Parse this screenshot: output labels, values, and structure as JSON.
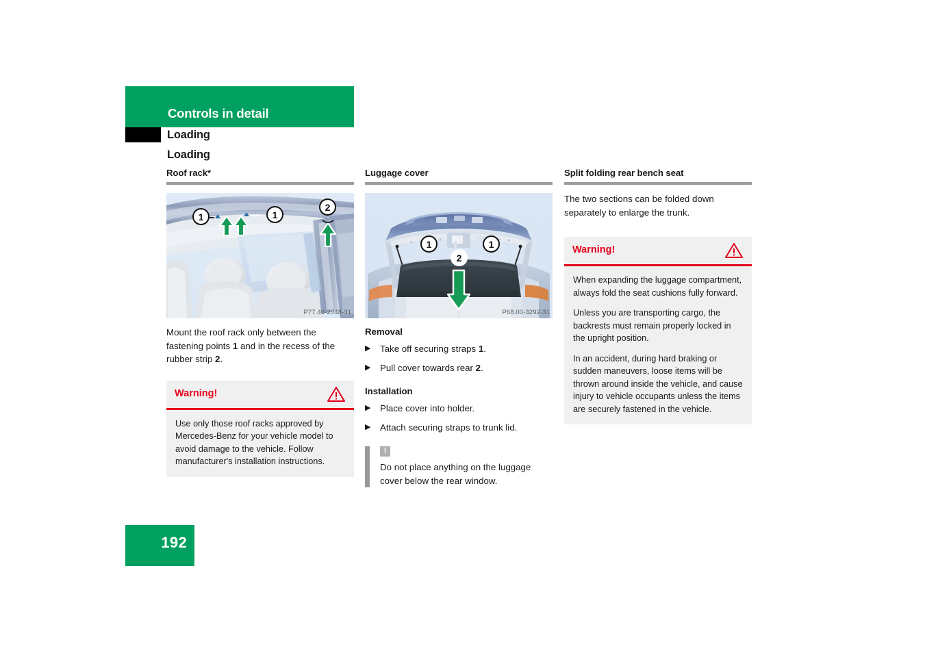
{
  "header": {
    "chapter": "Controls in detail",
    "running_head": "Loading",
    "section": "Loading"
  },
  "columns": {
    "col1": {
      "title": "Roof rack*",
      "figure": {
        "code": "P77.40-2048-31",
        "callouts": [
          "1",
          "1",
          "2"
        ],
        "alt": "car interior roof with fastening points"
      },
      "paragraph_html": "Mount the roof rack only between the fastening points <b>1</b> and in the recess of the rubber strip <b>2</b>.",
      "warning": {
        "title": "Warning!",
        "icon": "warning-triangle-icon",
        "paragraphs": [
          "Use only those roof racks approved by Mercedes-Benz for your vehicle model to avoid damage to the vehicle. Follow manufacturer's installation instructions."
        ]
      }
    },
    "col2": {
      "title": "Luggage cover",
      "figure": {
        "code": "P68.00-3292-31",
        "callouts": [
          "1",
          "1",
          "2"
        ],
        "alt": "open trunk lid with luggage cover"
      },
      "removal_head": "Removal",
      "removal_items_html": [
        "Take off securing straps <b>1</b>.",
        "Pull cover towards rear <b>2</b>."
      ],
      "installation_head": "Installation",
      "installation_items_html": [
        "Place cover into holder.",
        "Attach securing straps to trunk lid."
      ],
      "note": {
        "icon": "!",
        "text": "Do not place anything on the luggage cover below the rear window."
      }
    },
    "col3": {
      "title": "Split folding rear bench seat",
      "paragraph": "The two sections can be folded down separately to enlarge the trunk.",
      "warning": {
        "title": "Warning!",
        "icon": "warning-triangle-icon",
        "paragraphs": [
          "When expanding the luggage compartment, always fold the seat cushions fully forward.",
          "Unless you are transporting cargo, the backrests must remain properly locked in the upright position.",
          "In an accident, during hard braking or sudden maneuvers, loose items will be thrown around inside the vehicle, and cause injury to vehicle occupants unless the items are securely fastened in the vehicle."
        ]
      }
    }
  },
  "footer": {
    "page_number": "192"
  },
  "colors": {
    "brand_green": "#00a160",
    "warning_red": "#e4001b",
    "rule_gray": "#9d9d9d",
    "box_gray": "#f0f0f0",
    "arrow_green": "#159b56"
  }
}
